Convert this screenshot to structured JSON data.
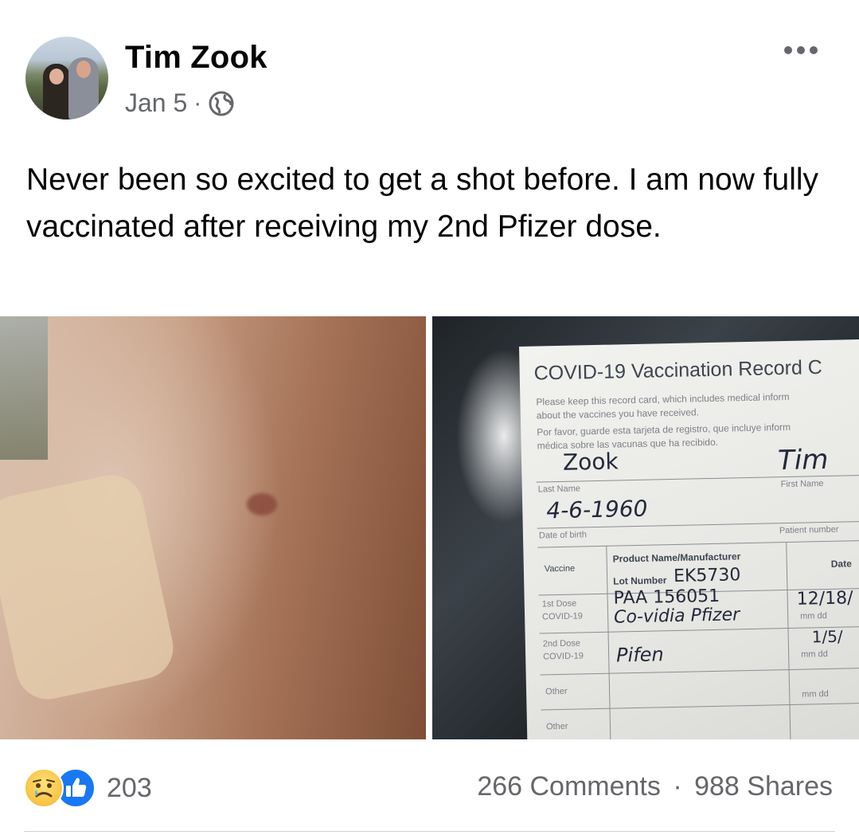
{
  "post": {
    "author": "Tim Zook",
    "date": "Jan 5",
    "separator": "·",
    "privacy_icon": "globe-icon",
    "more_icon": "more-options-icon",
    "text": "Never been so excited to get a shot before. I am now fully vaccinated after receiving my 2nd Pfizer dose."
  },
  "vaccination_card": {
    "title": "COVID-19 Vaccination Record C",
    "note_en_1": "Please keep this record card, which includes medical inform",
    "note_en_2": "about the vaccines you have received.",
    "note_es_1": "Por favor, guarde esta tarjeta de registro, que incluye inform",
    "note_es_2": "médica sobre las vacunas que ha recibido.",
    "last_name": "Zook",
    "first_name": "Tim",
    "last_name_label": "Last Name",
    "first_name_label": "First Name",
    "dob": "4-6-1960",
    "dob_label": "Date of birth",
    "patient_number_label": "Patient number",
    "col_vaccine": "Vaccine",
    "col_product": "Product Name/Manufacturer",
    "col_lot": "Lot Number",
    "lot_number": "EK5730",
    "col_date": "Date",
    "dose1_label": "1st Dose",
    "dose1_vaccine": "COVID-19",
    "dose1_lot": "PAA 156051",
    "dose1_product": "Co-vidia Pfizer",
    "dose1_date": "12/18/",
    "dose2_label": "2nd Dose",
    "dose2_vaccine": "COVID-19",
    "dose2_product": "Pifen",
    "dose2_date": "1/5/",
    "date_hint": "mm dd",
    "other_label_1": "Other",
    "other_label_2": "Other"
  },
  "footer": {
    "reaction_icons": [
      "sad-reaction-icon",
      "like-reaction-icon"
    ],
    "reaction_count": "203",
    "comments": "266 Comments",
    "separator": "·",
    "shares": "988 Shares"
  }
}
